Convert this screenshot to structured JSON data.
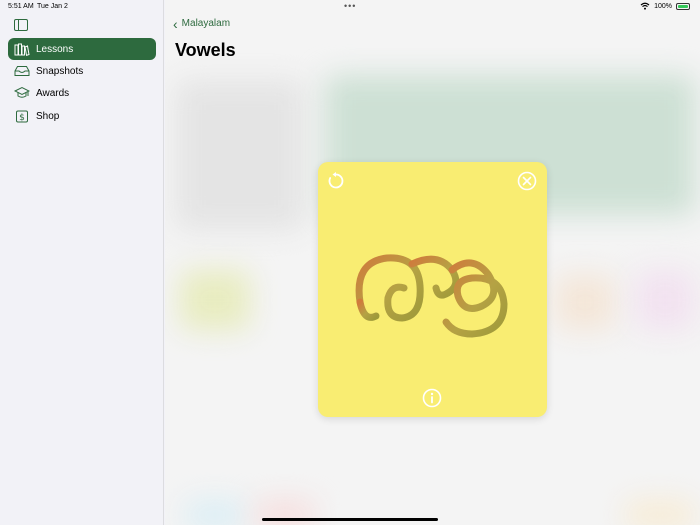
{
  "status": {
    "time": "5:51 AM",
    "date": "Tue Jan 2",
    "battery": "100%"
  },
  "sidebar": {
    "items": [
      {
        "label": "Lessons",
        "icon": "books-icon",
        "active": true
      },
      {
        "label": "Snapshots",
        "icon": "tray-icon",
        "active": false
      },
      {
        "label": "Awards",
        "icon": "graduation-cap-icon",
        "active": false
      },
      {
        "label": "Shop",
        "icon": "dollar-sign-icon",
        "active": false
      }
    ]
  },
  "header": {
    "back_label": "Malayalam",
    "title": "Vowels"
  },
  "card": {
    "glyph": "ഔ",
    "background": "#f9ed72"
  },
  "colors": {
    "accent": "#2d6a3e"
  }
}
